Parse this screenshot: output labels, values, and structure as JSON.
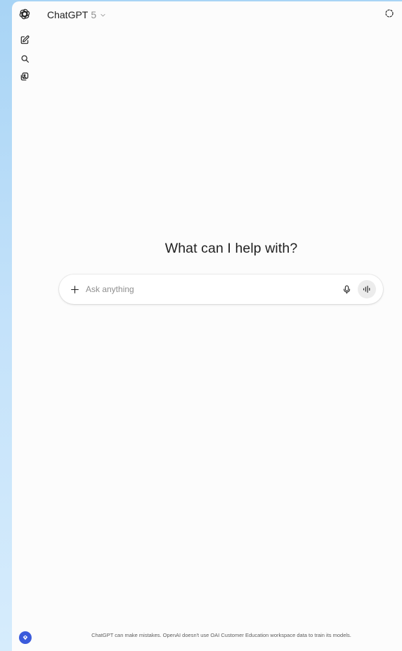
{
  "header": {
    "model_name": "ChatGPT",
    "model_version": "5"
  },
  "sidebar": {
    "items": [
      {
        "icon": "openai-logo-icon"
      },
      {
        "icon": "new-chat-icon"
      },
      {
        "icon": "search-icon"
      },
      {
        "icon": "library-icon"
      }
    ]
  },
  "main": {
    "title": "What can I help with?"
  },
  "composer": {
    "placeholder": "Ask anything",
    "value": ""
  },
  "footer": {
    "disclaimer": "ChatGPT can make mistakes. OpenAI doesn't use OAI Customer Education workspace data to train its models."
  },
  "colors": {
    "background": "#fcfcfc",
    "desktop": "#b8dbf7",
    "profile_accent": "#3b5bdb",
    "text_primary": "#1f1f1f",
    "text_muted": "#8f8f8f"
  }
}
